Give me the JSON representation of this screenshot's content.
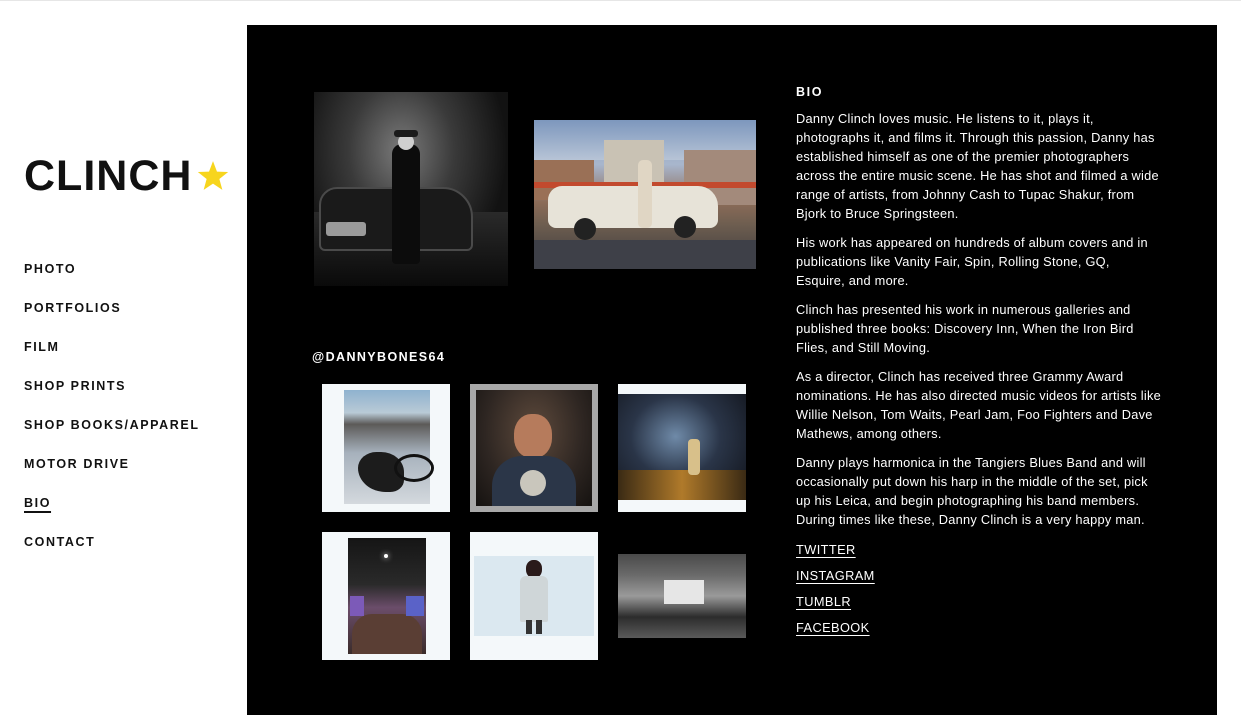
{
  "logo": {
    "text": "CLINCH",
    "star_color": "#f7d51d"
  },
  "nav": {
    "items": [
      {
        "label": "PHOTO",
        "active": false
      },
      {
        "label": "PORTFOLIOS",
        "active": false
      },
      {
        "label": "FILM",
        "active": false
      },
      {
        "label": "SHOP PRINTS",
        "active": false
      },
      {
        "label": "SHOP BOOKS/APPAREL",
        "active": false
      },
      {
        "label": "MOTOR DRIVE",
        "active": false
      },
      {
        "label": "BIO",
        "active": true
      },
      {
        "label": "CONTACT",
        "active": false
      }
    ]
  },
  "instagram": {
    "handle": "@DANNYBONES64"
  },
  "bio": {
    "heading": "BIO",
    "paragraphs": [
      "Danny Clinch loves music. He listens to it, plays it, photographs it, and films it. Through this passion, Danny has established himself as one of the premier photographers across the entire music scene. He has shot and filmed a wide range of artists, from Johnny Cash to Tupac Shakur, from Bjork to Bruce Springsteen.",
      "His work has appeared on hundreds of album covers and in publications like Vanity Fair, Spin, Rolling Stone, GQ, Esquire, and more.",
      "Clinch has presented his work in numerous galleries and published three books: Discovery Inn, When the Iron Bird Flies, and Still Moving.",
      "As a director, Clinch has received three Grammy Award nominations. He has also directed music videos for artists like Willie Nelson, Tom Waits, Pearl Jam, Foo Fighters and Dave Mathews, among others.",
      "Danny plays harmonica in the Tangiers Blues Band and will occasionally put down his harp in the middle of the set, pick up his Leica, and begin photographing his band members. During times like these, Danny Clinch is a very happy man."
    ],
    "links": [
      "TWITTER",
      "INSTAGRAM",
      "TUMBLR",
      "FACEBOOK"
    ]
  },
  "colors": {
    "panel": "#000000",
    "accent": "#f7d51d",
    "text_dark": "#111111"
  }
}
